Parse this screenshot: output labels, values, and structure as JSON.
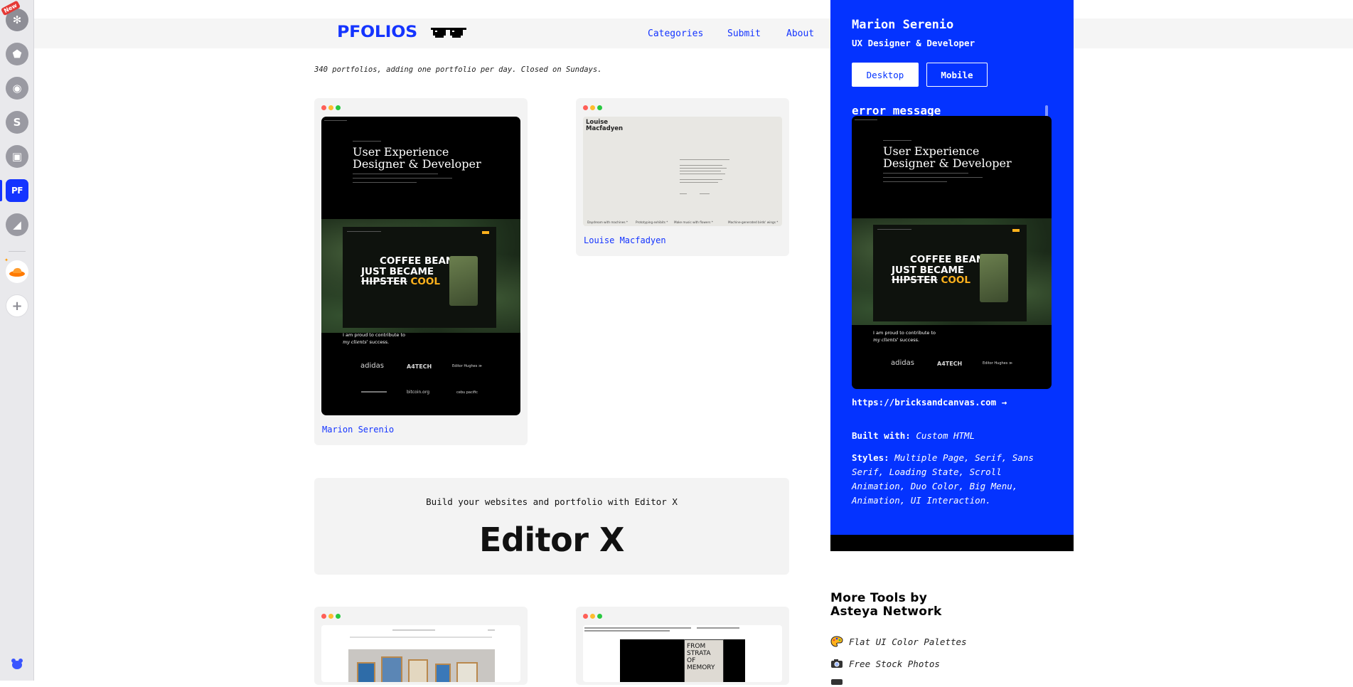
{
  "dock": {
    "new_badge": "New",
    "items": [
      {
        "name": "snowflake-app-icon",
        "glyph": "✻"
      },
      {
        "name": "shield-app-icon",
        "glyph": "⬟"
      },
      {
        "name": "palette-app-icon",
        "glyph": "◉"
      },
      {
        "name": "s-app-icon",
        "glyph": "S"
      },
      {
        "name": "tabs-app-icon",
        "glyph": "▣"
      },
      {
        "name": "pfolios-app-icon",
        "glyph": "PF"
      },
      {
        "name": "chart-app-icon",
        "glyph": "◢"
      },
      {
        "name": "hat-app-icon",
        "glyph": ""
      },
      {
        "name": "add-app-icon",
        "glyph": "+"
      }
    ]
  },
  "header": {
    "logo": "PFOLIOS",
    "nav": [
      "Categories",
      "Submit",
      "About"
    ]
  },
  "tagline": "340 portfolios, adding one portfolio per day. Closed on Sundays.",
  "cards": [
    {
      "name": "Marion Serenio",
      "preview": {
        "hero": "User Experience Designer & Developer",
        "coffee_1": "COFFEE BEANS",
        "coffee_2": "JUST BECAME",
        "coffee_3a": "HIPSTER",
        "coffee_3b": "COOL",
        "proud_1": "I am proud to contribute to",
        "proud_2a": "my clients'",
        "proud_2b": "success.",
        "brands": [
          "adidas",
          "A4TECH",
          "Editor Hughes ≫",
          "bitcoin.org",
          "cebu pacific"
        ]
      }
    },
    {
      "name": "Louise Macfadyen",
      "preview": {
        "title_1": "Louise",
        "title_2": "Macfadyen",
        "footer": [
          "Daydream with machines *",
          "Prototyping exhibits *",
          "Make music with flowers *",
          "Machine-generated birds' wings *"
        ]
      }
    }
  ],
  "ad": {
    "text": "Build your websites and portfolio with Editor X",
    "logo": "Editor X"
  },
  "bottom_cards": [
    {
      "preview": "framed prints"
    },
    {
      "preview_text": "FROM STRATA OF MEMORY"
    }
  ],
  "panel": {
    "name": "Marion Serenio",
    "role": "UX Designer & Developer",
    "btn_desktop": "Desktop",
    "btn_mobile": "Mobile",
    "error": "error message",
    "link": "https://bricksandcanvas.com →",
    "built_label": "Built with:",
    "built_value": "Custom HTML",
    "styles_label": "Styles:",
    "styles_value": "Multiple Page, Serif, Sans Serif, Loading State, Scroll Animation, Duo Color, Big Menu, Animation, UI Interaction."
  },
  "more_tools": {
    "title_1": "More Tools by",
    "title_2": "Asteya Network",
    "items": [
      {
        "icon": "palette-icon",
        "label": "Flat UI Color Palettes"
      },
      {
        "icon": "camera-icon",
        "label": "Free Stock Photos"
      }
    ]
  },
  "colors": {
    "accent": "#1434ff",
    "panel": "#0433ff",
    "highlight": "#ffb21c"
  }
}
